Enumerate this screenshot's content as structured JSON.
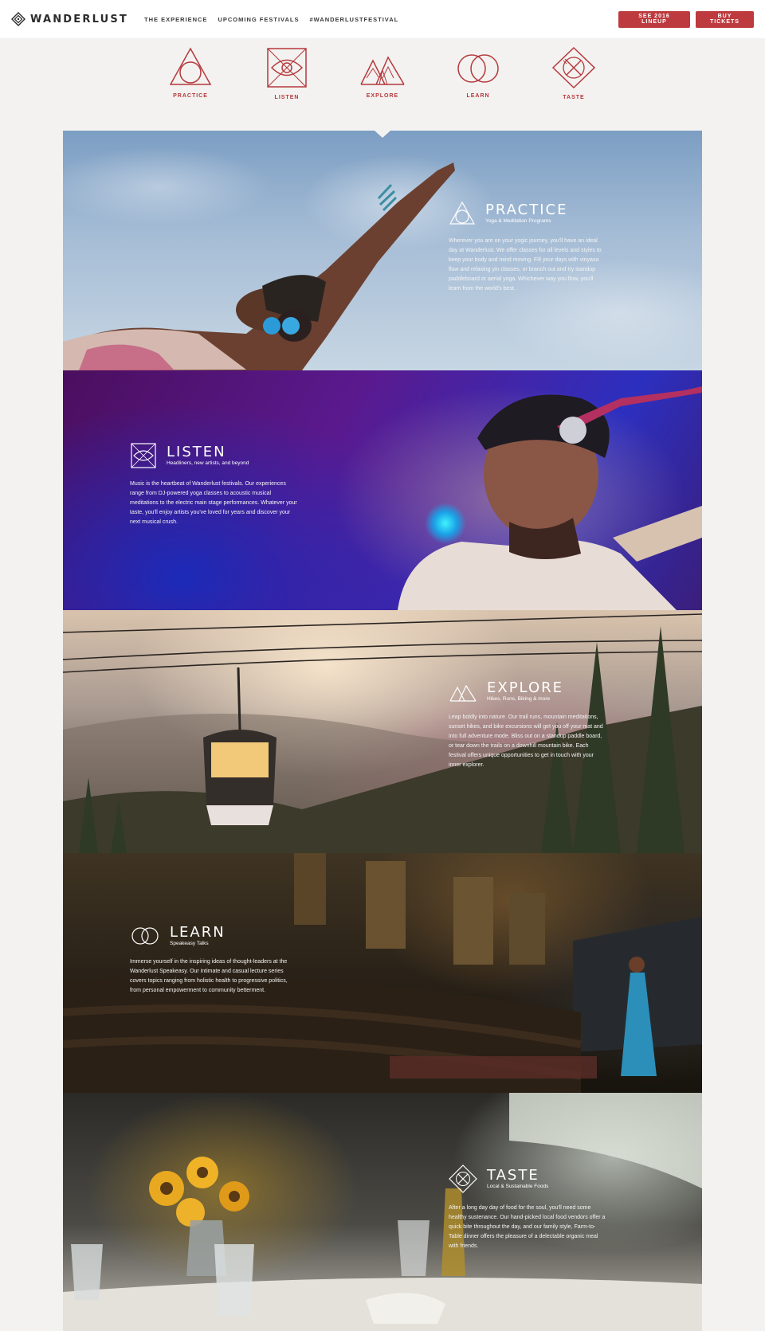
{
  "header": {
    "brand": "WANDERLUST",
    "nav": [
      {
        "label": "THE EXPERIENCE"
      },
      {
        "label": "UPCOMING FESTIVALS"
      },
      {
        "label": "#WANDERLUSTFESTIVAL"
      }
    ],
    "buttons": {
      "lineup": "SEE 2016 LINEUP",
      "tickets": "BUY TICKETS"
    }
  },
  "categories": [
    {
      "label": "PRACTICE",
      "icon": "triangle-circle-icon"
    },
    {
      "label": "LISTEN",
      "icon": "eye-box-icon"
    },
    {
      "label": "EXPLORE",
      "icon": "mountains-icon"
    },
    {
      "label": "LEARN",
      "icon": "overlapping-circles-icon"
    },
    {
      "label": "TASTE",
      "icon": "fork-knife-diamond-icon"
    }
  ],
  "sections": {
    "practice": {
      "title": "PRACTICE",
      "subtitle": "Yoga & Meditation Programs",
      "body": "Wherever you are on your yogic journey, you'll have an ideal day at Wanderlust. We offer classes for all levels and styles to keep your body and mind moving. Fill your days with vinyasa flow and relaxing yin classes, or branch out and try standup paddleboard or aerial yoga. Whichever way you flow, you'll learn from the world's best."
    },
    "listen": {
      "title": "LISTEN",
      "subtitle": "Headliners, new artists, and beyond",
      "body": "Music is the heartbeat of Wanderlust festivals. Our experiences range from DJ-powered yoga classes to acoustic musical meditations to the electric main stage performances. Whatever your taste, you'll enjoy artists you've loved for years and discover your next musical crush."
    },
    "explore": {
      "title": "EXPLORE",
      "subtitle": "Hikes, Runs, Biking & more",
      "body": "Leap boldly into nature. Our trail runs, mountain meditations, sunset hikes, and bike excursions will get you off your mat and into full adventure mode. Bliss out on a standup paddle board, or tear down the trails on a downhill mountain bike. Each festival offers unique opportunities to get in touch with your inner explorer."
    },
    "learn": {
      "title": "LEARN",
      "subtitle": "Speakeasy Talks",
      "body": "Immerse yourself in the inspiring ideas of thought-leaders at the Wanderlust Speakeasy. Our intimate and casual lecture series covers topics ranging from holistic health to progressive politics, from personal empowerment to community betterment."
    },
    "taste": {
      "title": "TASTE",
      "subtitle": "Local & Sustainable Foods",
      "body": "After a long day day of food for the soul, you'll need some healthy sustenance. Our hand-picked local food vendors offer a quick bite throughout the day, and our family style, Farm-to-Table dinner offers the pleasure of a delectable organic meal with friends."
    }
  },
  "colors": {
    "accent": "#bd3b3e",
    "page_bg": "#f3f2f0"
  }
}
